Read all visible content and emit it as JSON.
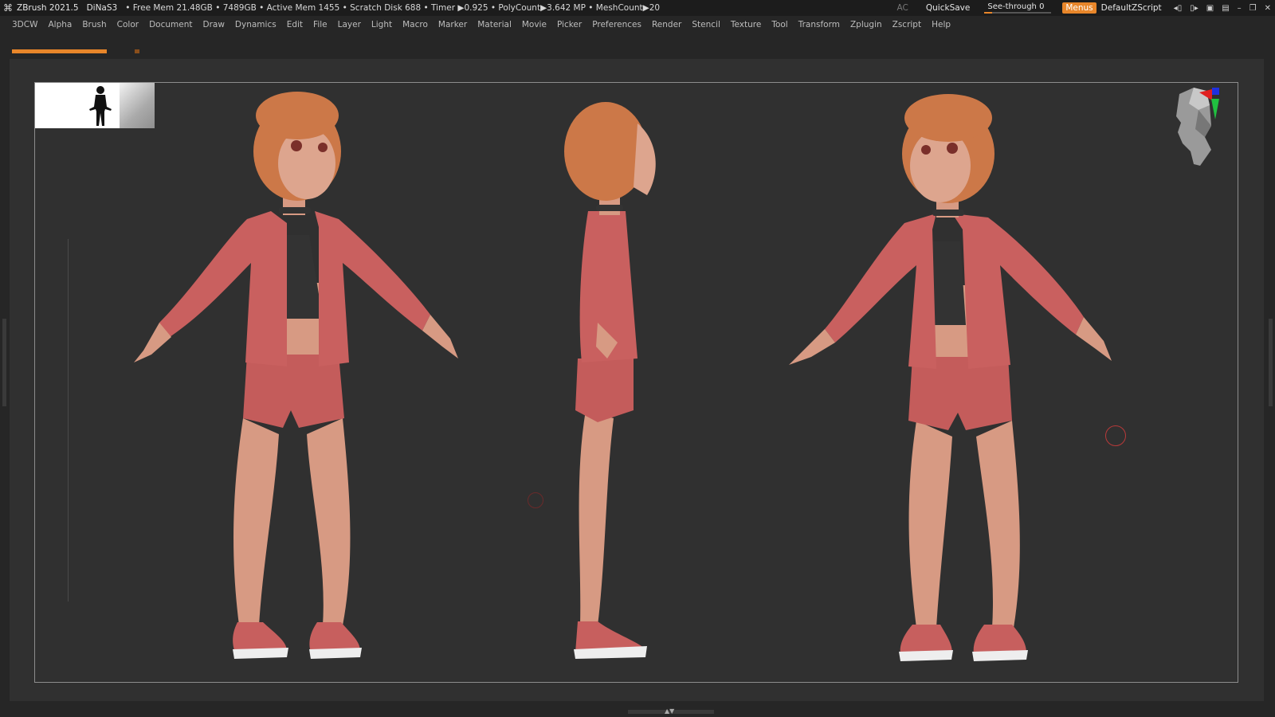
{
  "titlebar": {
    "app": "ZBrush 2021.5",
    "document": "DiNaS3",
    "stats": "• Free Mem 21.48GB • 7489GB • Active Mem 1455 • Scratch Disk 688 • Timer ▶0.925 • PolyCount▶3.642 MP • MeshCount▶20"
  },
  "topright": {
    "ac": "AC",
    "quicksave": "QuickSave",
    "seethrough_label": "See-through",
    "seethrough_value": "0",
    "seethrough_level": 0,
    "menus": "Menus",
    "zscript": "DefaultZScript"
  },
  "menu": [
    "3DCW",
    "Alpha",
    "Brush",
    "Color",
    "Document",
    "Draw",
    "Dynamics",
    "Edit",
    "File",
    "Layer",
    "Light",
    "Macro",
    "Marker",
    "Material",
    "Movie",
    "Picker",
    "Preferences",
    "Render",
    "Stencil",
    "Texture",
    "Tool",
    "Transform",
    "Zplugin",
    "Zscript",
    "Help"
  ],
  "colors": {
    "accent": "#e8862a",
    "jacket": "#c9605f",
    "skin": "#d79a83",
    "hair": "#cc7848",
    "top": "#333333",
    "sole": "#eeeeee"
  },
  "icons": {
    "logo": "zbrush-logo-icon",
    "gizmo": "orientation-head-icon"
  }
}
